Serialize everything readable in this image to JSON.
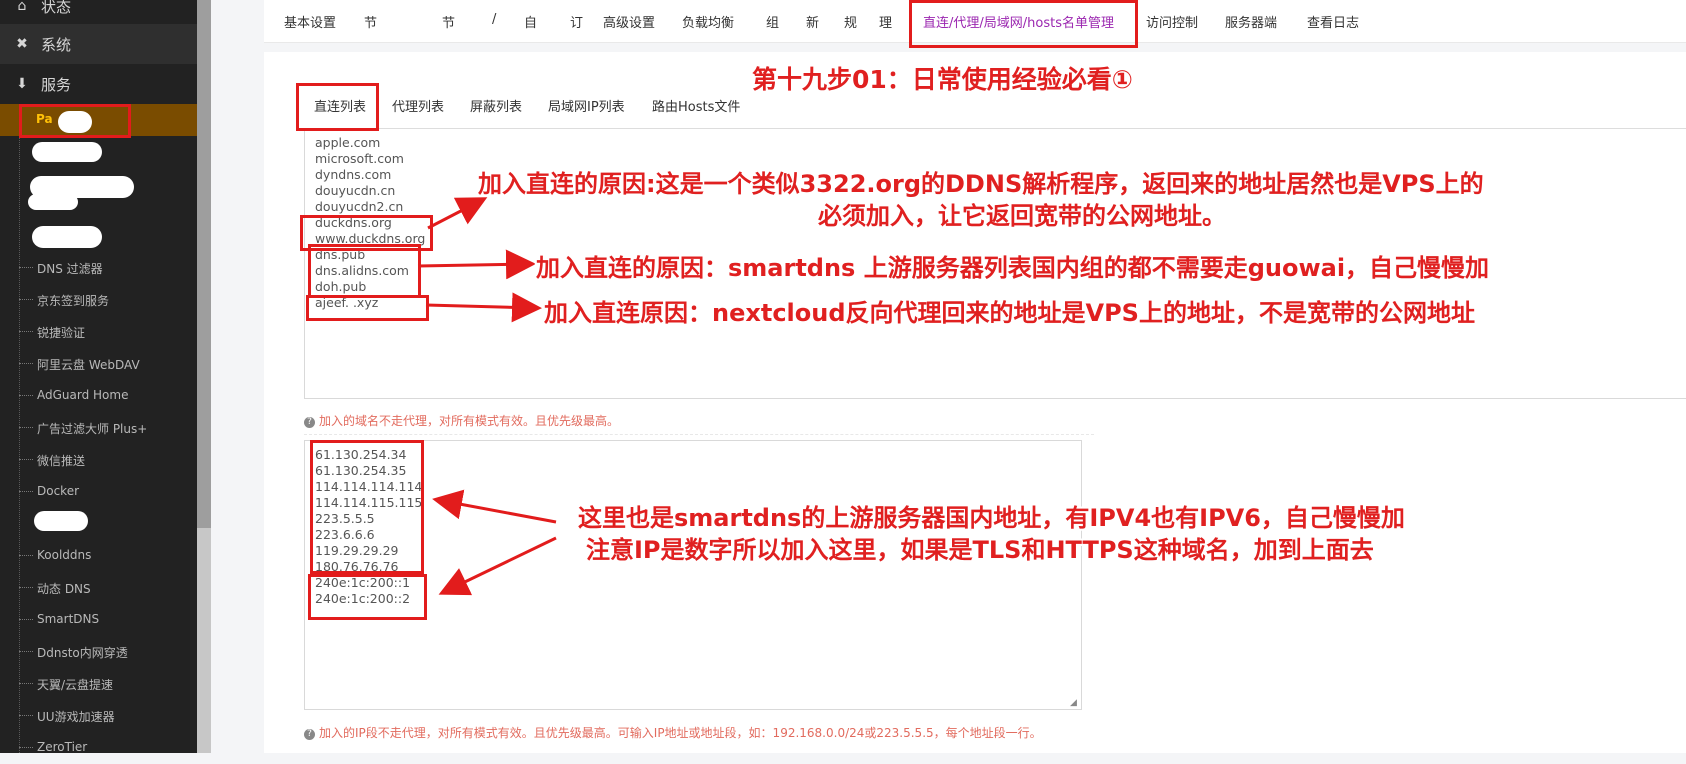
{
  "sidebar": {
    "categories": [
      {
        "label": "状态",
        "icon": "home-icon"
      },
      {
        "label": "系统",
        "icon": "tools-icon"
      },
      {
        "label": "服务",
        "icon": "download-icon"
      }
    ],
    "active_item": "Pa",
    "items": [
      "DNS 过滤器",
      "京东签到服务",
      "锐捷验证",
      "阿里云盘 WebDAV",
      "AdGuard Home",
      "广告过滤大师 Plus+",
      "微信推送",
      "Docker",
      "Koolddns",
      "动态 DNS",
      "SmartDNS",
      "Ddnsto内网穿透",
      "天翼/云盘提速",
      "UU游戏加速器",
      "ZeroTier"
    ]
  },
  "tabs": [
    "基本设置",
    "节",
    "节",
    "/",
    "自",
    "订",
    "高级设置",
    "负载均衡",
    "组",
    "新",
    "规",
    "理",
    "直连/代理/局域网/hosts名单管理",
    "访问控制",
    "服务器端",
    "查看日志"
  ],
  "subtabs": [
    "直连列表",
    "代理列表",
    "屏蔽列表",
    "局域网IP列表",
    "路由Hosts文件"
  ],
  "domain_list": [
    "apple.com",
    "microsoft.com",
    "dyndns.com",
    "douyucdn.cn",
    "douyucdn2.cn",
    "duckdns.org",
    "www.duckdns.org",
    "dns.pub",
    "dns.alidns.com",
    "doh.pub",
    "ajeef.          .xyz"
  ],
  "domain_hint": "加入的域名不走代理，对所有模式有效。且优先级最高。",
  "ip_list": [
    "61.130.254.34",
    "61.130.254.35",
    "114.114.114.114",
    "114.114.115.115",
    "223.5.5.5",
    "223.6.6.6",
    "119.29.29.29",
    "180.76.76.76",
    "240e:1c:200::1",
    "240e:1c:200::2"
  ],
  "ip_hint": "加入的IP段不走代理，对所有模式有效。且优先级最高。可输入IP地址或地址段，如：192.168.0.0/24或223.5.5.5，每个地址段一行。",
  "annotations": {
    "step": "第十九步01：日常使用经验必看①",
    "duckdns_1": "加入直连的原因:这是一个类似3322.org的DDNS解析程序，返回来的地址居然也是VPS上的",
    "duckdns_2": "必须加入，让它返回宽带的公网地址。",
    "dns": "加入直连的原因：smartdns 上游服务器列表国内组的都不需要走guowai，自己慢慢加",
    "nextcloud": "加入直连原因：nextcloud反向代理回来的地址是VPS上的地址，不是宽带的公网地址",
    "ip_1": "这里也是smartdns的上游服务器国内地址，有IPV4也有IPV6，自己慢慢加",
    "ip_2": "注意IP是数字所以加入这里，如果是TLS和HTTPS这种域名，加到上面去"
  },
  "colors": {
    "sidebar_bg": "#222222",
    "active_item_bg": "#7a4c00",
    "active_item_text": "#ffc107",
    "active_tab": "#9b27b0",
    "annotation_red": "#e21c1c",
    "hint": "#e26b5e"
  }
}
